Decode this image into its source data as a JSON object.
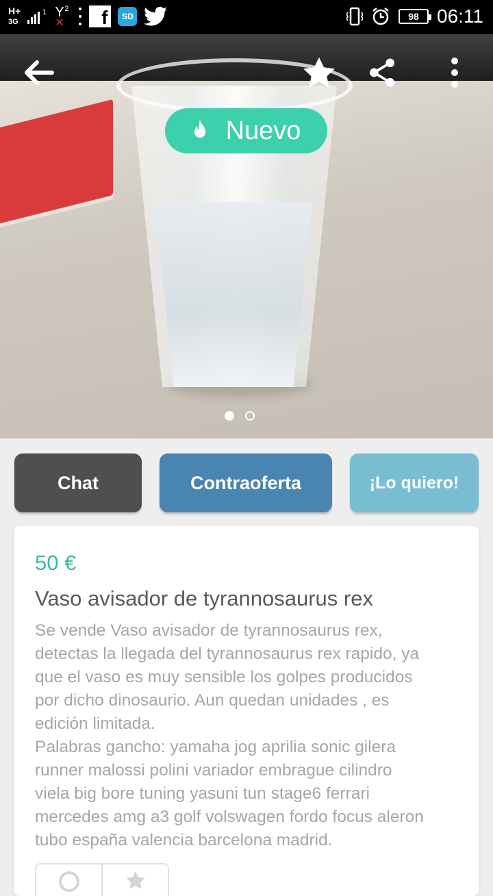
{
  "status_bar": {
    "network": "H+",
    "network_type": "3G",
    "sim1": "1",
    "sim2": "2",
    "battery": "98",
    "time": "06:11",
    "notification_icons": [
      "facebook-icon",
      "sd-card-icon",
      "twitter-icon"
    ],
    "sd_label": "SD"
  },
  "hero": {
    "badge_label": "Nuevo",
    "badge_color": "#3dd0ad",
    "image_count": 2,
    "current_image": 1
  },
  "actions": {
    "chat_label": "Chat",
    "offer_label": "Contraoferta",
    "want_label": "¡Lo quiero!",
    "chat_color": "#4f4f4f",
    "offer_color": "#4a84b0",
    "want_color": "#79bdd2"
  },
  "product": {
    "price": "50 €",
    "title": "Vaso avisador de tyrannosaurus rex",
    "description": "Se vende Vaso avisador de tyrannosaurus rex,\ndetectas la llegada del tyrannosaurus rex rapido, ya\nque el vaso es muy sensible los golpes producidos\npor dicho dinosaurio. Aun quedan unidades , es\nedición limitada.\n Palabras gancho: yamaha jog aprilia sonic gilera\nrunner malossi polini variador embrague cilindro\nviela big bore tuning yasuni tun stage6 ferrari\nmercedes amg a3 golf volswagen fordo focus aleron\ntubo españa valencia barcelona madrid.",
    "price_color": "#34bca4"
  }
}
